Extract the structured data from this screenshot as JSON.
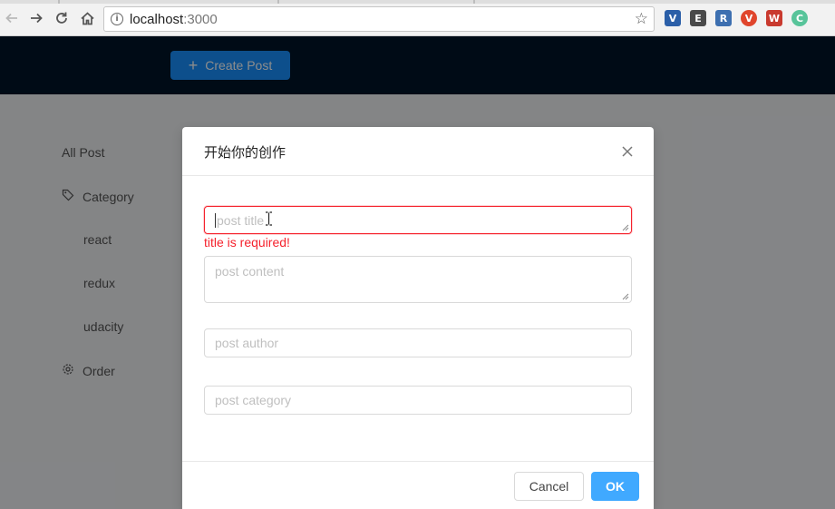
{
  "browser": {
    "url_host": "localhost",
    "url_port": ":3000",
    "icons": [
      "back-icon",
      "forward-icon",
      "reload-icon",
      "home-icon",
      "info-icon",
      "bookmark-star-icon"
    ],
    "extensions": [
      {
        "name": "vue-devtools-icon",
        "glyph": "V",
        "color": "#2b5fa8"
      },
      {
        "name": "evernote-icon",
        "glyph": "E",
        "color": "#4a4a4a"
      },
      {
        "name": "rss-icon",
        "glyph": "R",
        "color": "#3d6fb0"
      },
      {
        "name": "shield-extension-icon",
        "glyph": "V",
        "color": "#e0452c"
      },
      {
        "name": "puzzle-extension-icon",
        "glyph": "W",
        "color": "#c93a2f"
      },
      {
        "name": "circle-extension-icon",
        "glyph": "C",
        "color": "#58c49a"
      }
    ]
  },
  "header": {
    "create_label": "Create Post",
    "create_icon": "plus-icon"
  },
  "sidebar": {
    "items": [
      {
        "label": "All Post"
      },
      {
        "label": "Category",
        "icon": "tag-icon"
      },
      {
        "label": "react"
      },
      {
        "label": "redux"
      },
      {
        "label": "udacity"
      },
      {
        "label": "Order",
        "icon": "settings-icon"
      }
    ]
  },
  "modal": {
    "title": "开始你的创作",
    "close_icon": "close-icon",
    "fields": {
      "title": {
        "placeholder": "post title",
        "value": ""
      },
      "content": {
        "placeholder": "post content",
        "value": ""
      },
      "author": {
        "placeholder": "post author",
        "value": ""
      },
      "category": {
        "placeholder": "post category",
        "value": ""
      }
    },
    "title_error": "title is required!",
    "cancel_label": "Cancel",
    "ok_label": "OK"
  },
  "colors": {
    "header_bg": "#001529",
    "primary": "#1890ff",
    "ok_button": "#40a9ff",
    "error": "#f5222d"
  }
}
